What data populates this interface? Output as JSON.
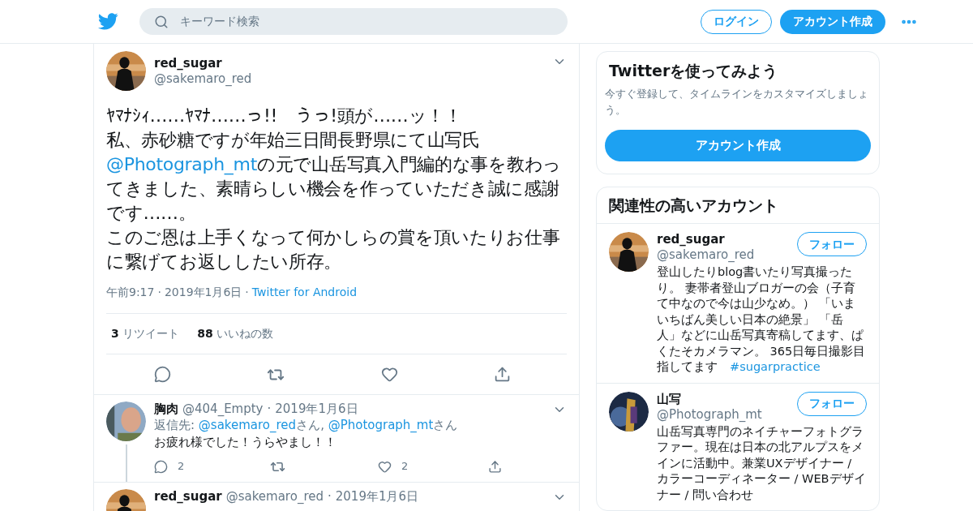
{
  "header": {
    "search": {
      "placeholder": "キーワード検索"
    },
    "login": "ログイン",
    "signup": "アカウント作成"
  },
  "tweet": {
    "name": "red_sugar",
    "handle": "@sakemaro_red",
    "paragraphs": [
      [
        {
          "kind": "text",
          "text": "ﾔﾏﾅｼｨ……ﾔﾏﾅ……っ!!　うっ!頭が……ッ！！"
        }
      ],
      [
        {
          "kind": "text",
          "text": "私、赤砂糖ですが年始三日間長野県にて山写氏"
        }
      ],
      [
        {
          "kind": "mention",
          "text": "@Photograph_mt"
        },
        {
          "kind": "text",
          "text": "の元で山岳写真入門編的な事を教わってきました、素晴らしい機会を作っていただき誠に感謝です……。"
        }
      ],
      [
        {
          "kind": "text",
          "text": "このご恩は上手くなって何かしらの賞を頂いたりお仕事に繋げてお返ししたい所存。"
        }
      ]
    ],
    "separator": "·",
    "time": "午前9:17",
    "date": "2019年1月6日",
    "source": "Twitter for Android",
    "retweets": "3",
    "retweets_label": "リツイート",
    "likes": "88",
    "likes_label": "いいねの数"
  },
  "replies": [
    {
      "name": "胸肉",
      "handle": "@404_Empty",
      "separator": "·",
      "date": "2019年1月6日",
      "thread": true,
      "reply_to": [
        {
          "kind": "text",
          "text": "返信先: "
        },
        {
          "kind": "mention",
          "text": "@sakemaro_red"
        },
        {
          "kind": "text",
          "text": "さん, "
        },
        {
          "kind": "mention",
          "text": "@Photograph_mt"
        },
        {
          "kind": "text",
          "text": "さん"
        }
      ],
      "text": "お疲れ様でした！うらやまし！！",
      "reply_count": "2",
      "like_count": "2"
    },
    {
      "name": "red_sugar",
      "handle": "@sakemaro_red",
      "separator": "·",
      "date": "2019年1月6日"
    }
  ],
  "signup_card": {
    "title": "Twitterを使ってみよう",
    "description": "今すぐ登録して、タイムラインをカスタマイズしましょう。",
    "button": "アカウント作成"
  },
  "related": {
    "title": "関連性の高いアカウント",
    "accounts": [
      {
        "name": "red_sugar",
        "handle": "@sakemaro_red",
        "follow": "フォロー",
        "bio": "登山したりblog書いたり写真撮ったり。 妻帯者登山ブロガーの会（子育て中なので今は山少なめ。） 「いまいちばん美しい日本の絶景」 「岳人」などに山岳写真寄稿してます、ぱくたそカメラマン。 365日毎日撮影目指してます　",
        "hashtag": "#sugarpractice"
      },
      {
        "name": "山写",
        "handle": "@Photograph_mt",
        "follow": "フォロー",
        "bio": "山岳写真専門のネイチャーフォトグラファー。現在は日本の北アルプスをメインに活動中。兼業UXデザイナー / カラーコーディネーター / WEBデザイナー / 問い合わせ"
      }
    ]
  }
}
